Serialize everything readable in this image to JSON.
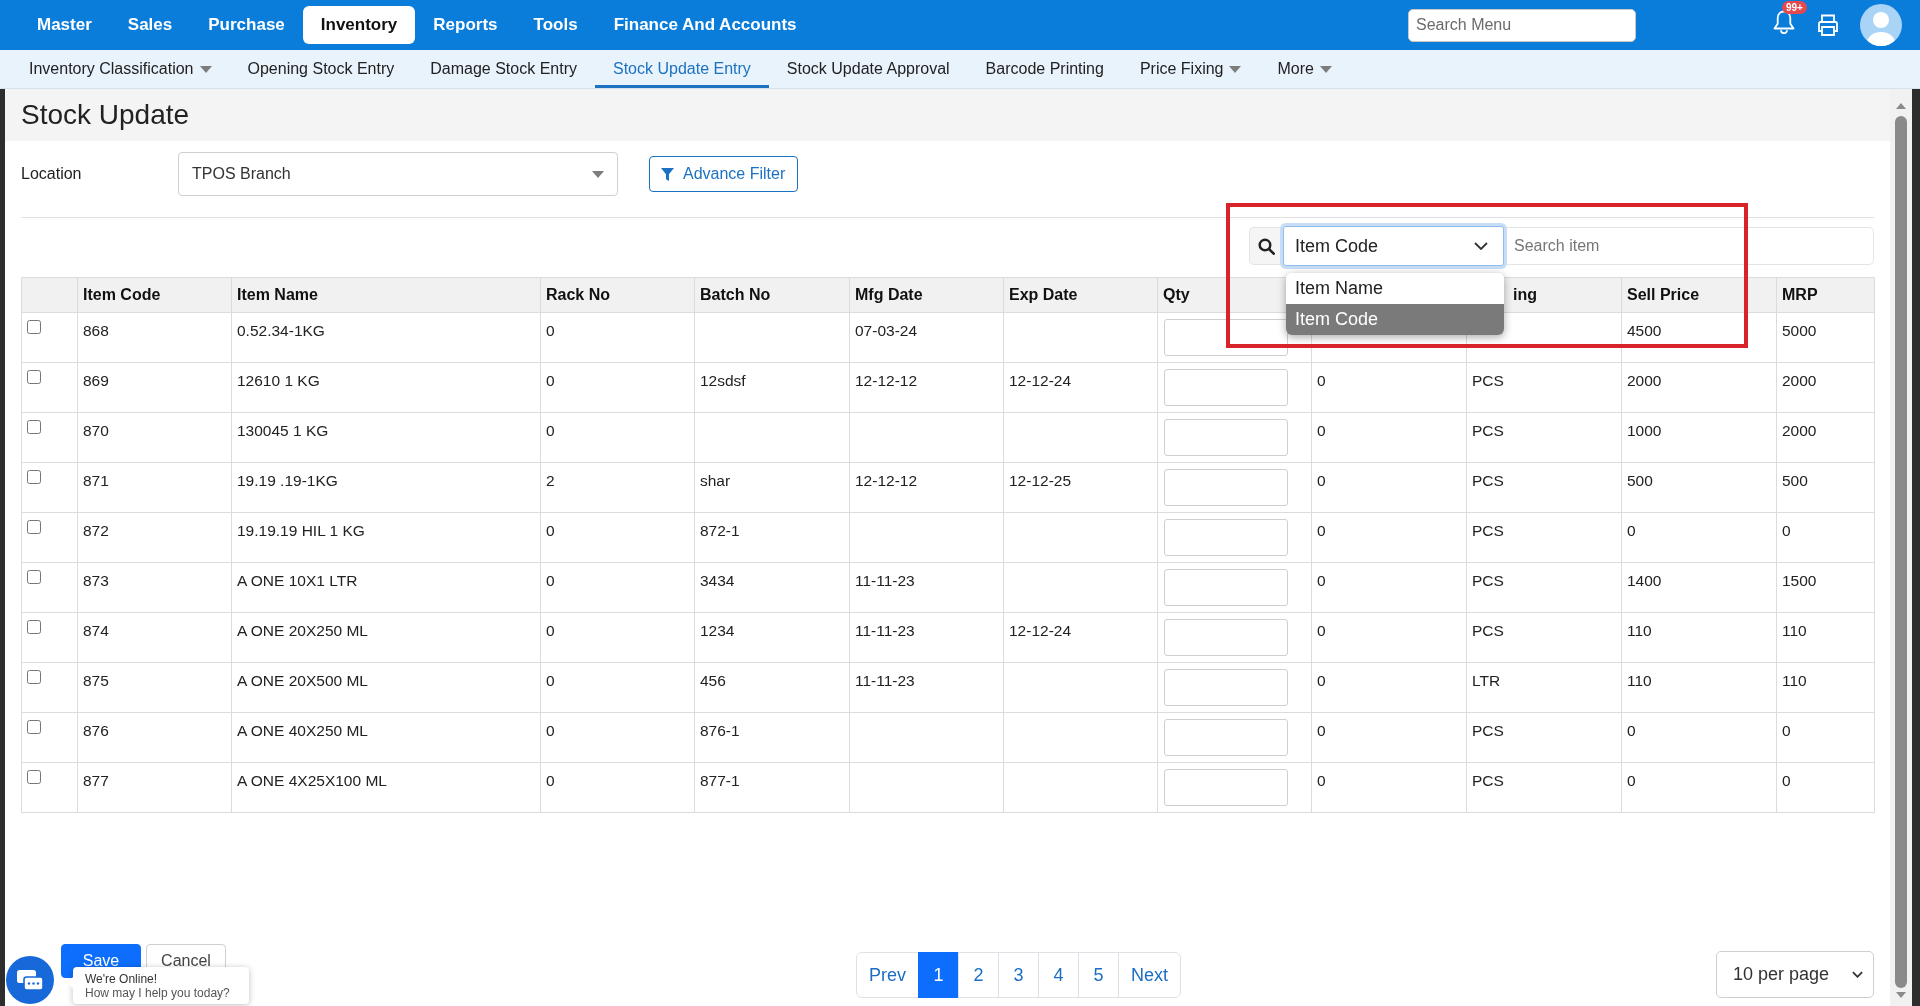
{
  "top_nav": {
    "items": [
      {
        "label": "Master",
        "selected": false
      },
      {
        "label": "Sales",
        "selected": false
      },
      {
        "label": "Purchase",
        "selected": false
      },
      {
        "label": "Inventory",
        "selected": true
      },
      {
        "label": "Reports",
        "selected": false
      },
      {
        "label": "Tools",
        "selected": false
      },
      {
        "label": "Finance And Accounts",
        "selected": false
      }
    ],
    "search": {
      "placeholder": "Search Menu"
    },
    "notification_badge": "99+"
  },
  "sub_nav": {
    "items": [
      {
        "label": "Inventory Classification",
        "has_menu": true,
        "selected": false
      },
      {
        "label": "Opening Stock Entry",
        "has_menu": false,
        "selected": false
      },
      {
        "label": "Damage Stock Entry",
        "has_menu": false,
        "selected": false
      },
      {
        "label": "Stock Update Entry",
        "has_menu": false,
        "selected": true
      },
      {
        "label": "Stock Update Approval",
        "has_menu": false,
        "selected": false
      },
      {
        "label": "Barcode Printing",
        "has_menu": false,
        "selected": false
      },
      {
        "label": "Price Fixing",
        "has_menu": true,
        "selected": false
      },
      {
        "label": "More",
        "has_menu": true,
        "selected": false
      }
    ]
  },
  "title": "Stock Update",
  "filters": {
    "location": {
      "label": "Location",
      "value": "TPOS Branch"
    },
    "advance_filter": "Advance Filter"
  },
  "search": {
    "highlighted": true,
    "field": {
      "value": "Item Code",
      "expanded": true,
      "options": [
        {
          "label": "Item Name",
          "selected": false
        },
        {
          "label": "Item Code",
          "selected": true
        }
      ]
    },
    "placeholder": "Search item"
  },
  "table": {
    "columns": [
      {
        "label": "Item Code",
        "kind": "text"
      },
      {
        "label": "Item Name",
        "kind": "text"
      },
      {
        "label": "Rack No",
        "kind": "text"
      },
      {
        "label": "Batch No",
        "kind": "text"
      },
      {
        "label": "Mfg Date",
        "kind": "text"
      },
      {
        "label": "Exp Date",
        "kind": "text"
      },
      {
        "label": "Qty",
        "kind": "input"
      },
      {
        "kind": "text"
      },
      {
        "label": "ing",
        "kind": "text"
      },
      {
        "label": "Sell Price",
        "kind": "text"
      },
      {
        "label": "MRP",
        "kind": "text"
      }
    ],
    "rows": [
      {
        "checked": false,
        "cells": [
          "868",
          "0.52.34-1KG",
          "0",
          null,
          "07-03-24",
          null,
          null,
          null,
          null,
          "4500",
          "5000"
        ]
      },
      {
        "checked": false,
        "cells": [
          "869",
          "12610 1 KG",
          "0",
          "12sdsf",
          "12-12-12",
          "12-12-24",
          null,
          "0",
          "PCS",
          "2000",
          "2000"
        ]
      },
      {
        "checked": false,
        "cells": [
          "870",
          "130045 1 KG",
          "0",
          null,
          null,
          null,
          null,
          "0",
          "PCS",
          "1000",
          "2000"
        ]
      },
      {
        "checked": false,
        "cells": [
          "871",
          "19.19 .19-1KG",
          "2",
          "shar",
          "12-12-12",
          "12-12-25",
          null,
          "0",
          "PCS",
          "500",
          "500"
        ]
      },
      {
        "checked": false,
        "cells": [
          "872",
          "19.19.19 HIL 1 KG",
          "0",
          "872-1",
          null,
          null,
          null,
          "0",
          "PCS",
          "0",
          "0"
        ]
      },
      {
        "checked": false,
        "cells": [
          "873",
          "A ONE 10X1 LTR",
          "0",
          "3434",
          "11-11-23",
          null,
          null,
          "0",
          "PCS",
          "1400",
          "1500"
        ]
      },
      {
        "checked": false,
        "cells": [
          "874",
          "A ONE 20X250 ML",
          "0",
          "1234",
          "11-11-23",
          "12-12-24",
          null,
          "0",
          "PCS",
          "110",
          "110"
        ]
      },
      {
        "checked": false,
        "cells": [
          "875",
          "A ONE 20X500 ML",
          "0",
          "456",
          "11-11-23",
          null,
          null,
          "0",
          "LTR",
          "110",
          "110"
        ]
      },
      {
        "checked": false,
        "cells": [
          "876",
          "A ONE 40X250 ML",
          "0",
          "876-1",
          null,
          null,
          null,
          "0",
          "PCS",
          "0",
          "0"
        ]
      },
      {
        "checked": false,
        "cells": [
          "877",
          "A ONE 4X25X100 ML",
          "0",
          "877-1",
          null,
          null,
          null,
          "0",
          "PCS",
          "0",
          "0"
        ]
      }
    ]
  },
  "actions": [
    {
      "label": "Save",
      "kind": "primary"
    },
    {
      "label": "Cancel",
      "kind": "secondary"
    }
  ],
  "pagination": {
    "prev": "Prev",
    "pages": [
      {
        "label": "1",
        "selected": true
      },
      {
        "label": "2",
        "selected": false
      },
      {
        "label": "3",
        "selected": false
      },
      {
        "label": "4",
        "selected": false
      },
      {
        "label": "5",
        "selected": false
      }
    ],
    "next": "Next"
  },
  "page_size": "10 per page",
  "chat": {
    "title": "We're Online!",
    "message": "How may I help you today?"
  }
}
